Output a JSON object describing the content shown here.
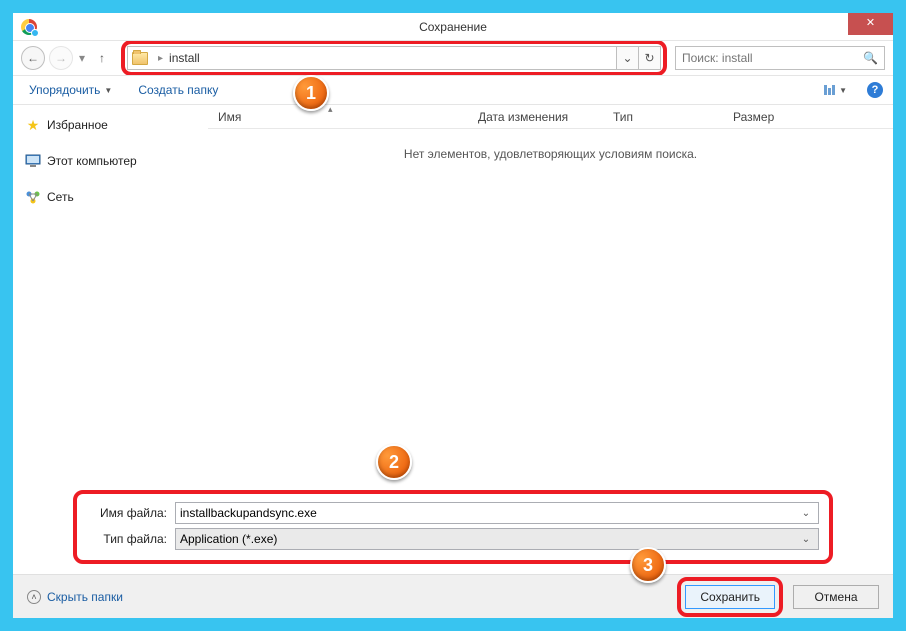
{
  "window": {
    "title": "Сохранение"
  },
  "nav": {
    "path_label": "install",
    "search_placeholder": "Поиск: install"
  },
  "toolbar": {
    "organize": "Упорядочить",
    "new_folder": "Создать папку"
  },
  "sidebar": {
    "favorites": "Избранное",
    "this_pc": "Этот компьютер",
    "network": "Сеть"
  },
  "columns": {
    "name": "Имя",
    "date": "Дата изменения",
    "type": "Тип",
    "size": "Размер"
  },
  "list": {
    "empty": "Нет элементов, удовлетворяющих условиям поиска."
  },
  "inputs": {
    "filename_label": "Имя файла:",
    "filename_value": "installbackupandsync.exe",
    "filetype_label": "Тип файла:",
    "filetype_value": "Application (*.exe)"
  },
  "footer": {
    "hide_folders": "Скрыть папки",
    "save": "Сохранить",
    "cancel": "Отмена"
  },
  "callouts": {
    "one": "1",
    "two": "2",
    "three": "3"
  }
}
